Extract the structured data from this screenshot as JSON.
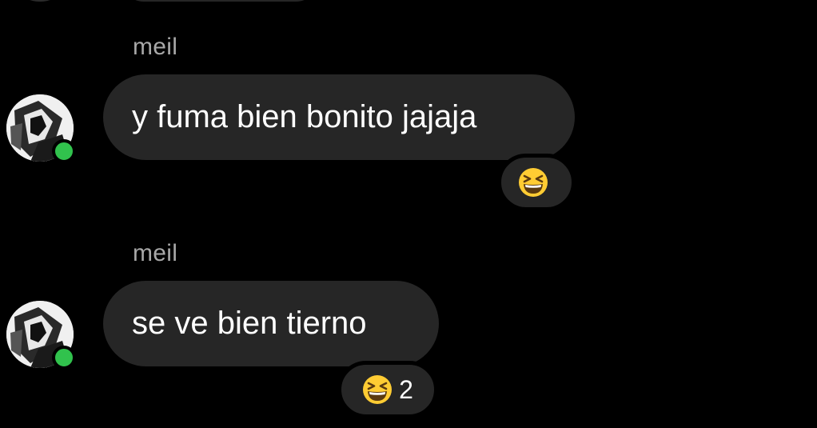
{
  "theme": {
    "background": "#000000",
    "bubble": "#262626",
    "sender_color": "#a8a8a8",
    "online_color": "#31c24d"
  },
  "messages": [
    {
      "sender": "meil",
      "text": "y fuma bien bonito jajaja",
      "reaction": {
        "emoji": "grinning-squinting-face",
        "count": ""
      }
    },
    {
      "sender": "meil",
      "text": "se ve bien tierno",
      "reaction": {
        "emoji": "grinning-squinting-face",
        "count": "2"
      }
    }
  ]
}
